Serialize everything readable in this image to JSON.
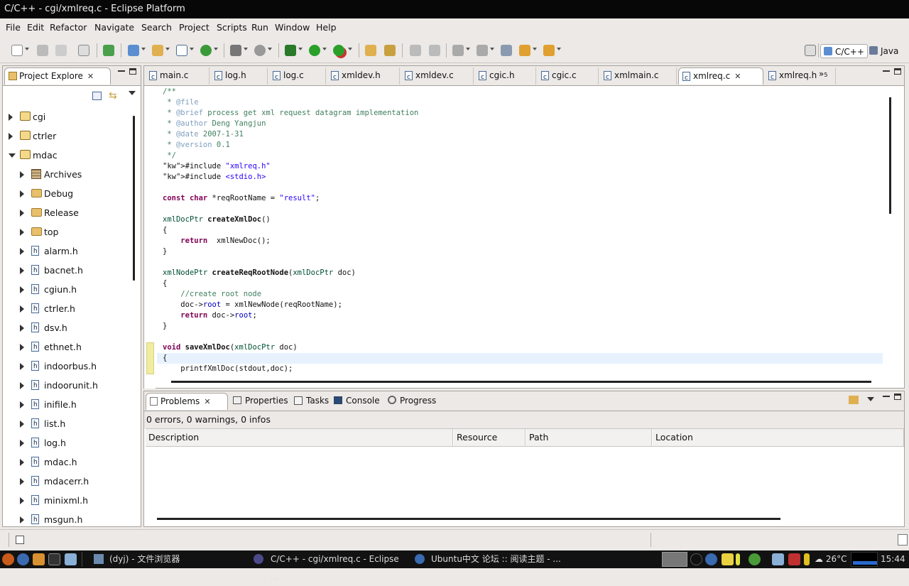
{
  "window": {
    "title": "C/C++ - cgi/xmlreq.c - Eclipse Platform"
  },
  "menu": [
    "File",
    "Edit",
    "Refactor",
    "Navigate",
    "Search",
    "Project",
    "Scripts",
    "Run",
    "Window",
    "Help"
  ],
  "perspectives": {
    "cpp": "C/C++",
    "java": "Java"
  },
  "explorer": {
    "title": "Project Explore",
    "items": [
      {
        "label": "cgi",
        "type": "project",
        "level": 0,
        "expanded": false
      },
      {
        "label": "ctrler",
        "type": "project",
        "level": 0,
        "expanded": false
      },
      {
        "label": "mdac",
        "type": "project",
        "level": 0,
        "expanded": true
      },
      {
        "label": "Archives",
        "type": "archives",
        "level": 1
      },
      {
        "label": "Debug",
        "type": "folder",
        "level": 1
      },
      {
        "label": "Release",
        "type": "folder",
        "level": 1
      },
      {
        "label": "top",
        "type": "folder",
        "level": 1
      },
      {
        "label": "alarm.h",
        "type": "header",
        "level": 1
      },
      {
        "label": "bacnet.h",
        "type": "header",
        "level": 1
      },
      {
        "label": "cgiun.h",
        "type": "header",
        "level": 1
      },
      {
        "label": "ctrler.h",
        "type": "header",
        "level": 1
      },
      {
        "label": "dsv.h",
        "type": "header",
        "level": 1
      },
      {
        "label": "ethnet.h",
        "type": "header",
        "level": 1
      },
      {
        "label": "indoorbus.h",
        "type": "header",
        "level": 1
      },
      {
        "label": "indoorunit.h",
        "type": "header",
        "level": 1
      },
      {
        "label": "inifile.h",
        "type": "header",
        "level": 1
      },
      {
        "label": "list.h",
        "type": "header",
        "level": 1
      },
      {
        "label": "log.h",
        "type": "header",
        "level": 1
      },
      {
        "label": "mdac.h",
        "type": "header",
        "level": 1
      },
      {
        "label": "mdacerr.h",
        "type": "header",
        "level": 1
      },
      {
        "label": "minixml.h",
        "type": "header",
        "level": 1
      },
      {
        "label": "msgun.h",
        "type": "header",
        "level": 1
      }
    ]
  },
  "editor": {
    "tabs": [
      "main.c",
      "log.h",
      "log.c",
      "xmldev.h",
      "xmldev.c",
      "cgic.h",
      "cgic.c",
      "xmlmain.c",
      "xmlreq.c",
      "xmlreq.h"
    ],
    "active_tab": "xmlreq.c",
    "overflow": "»",
    "overflow_count": "5",
    "code": [
      "/**",
      " * @file",
      " * @brief process get xml request datagram implementation",
      " * @author Deng Yangjun",
      " * @date 2007-1-31",
      " * @version 0.1",
      " */",
      "#include \"xmlreq.h\"",
      "#include <stdio.h>",
      "",
      "const char *reqRootName = \"result\";",
      "",
      "xmlDocPtr createXmlDoc()",
      "{",
      "    return  xmlNewDoc();",
      "}",
      "",
      "xmlNodePtr createReqRootNode(xmlDocPtr doc)",
      "{",
      "    //create root node",
      "    doc->root = xmlNewNode(reqRootName);",
      "    return doc->root;",
      "}",
      "",
      "void saveXmlDoc(xmlDocPtr doc)",
      "{",
      "    printfXmlDoc(stdout,doc);"
    ]
  },
  "bottom": {
    "tabs": [
      "Problems",
      "Properties",
      "Tasks",
      "Console",
      "Progress"
    ],
    "summary": "0 errors, 0 warnings, 0 infos",
    "columns": [
      "Description",
      "Resource",
      "Path",
      "Location"
    ]
  },
  "taskbar": {
    "items": [
      "(dyj) - 文件浏览器",
      "C/C++ - cgi/xmlreq.c - Eclipse ...",
      "Ubuntu中文 论坛 :: 阅读主题 - ..."
    ],
    "weather": "26°C",
    "clock": "15:44"
  },
  "colors": {
    "titlebar": "#070707",
    "panel_bg": "#ece9e6",
    "comment": "#3f7f5f",
    "keyword": "#7f0055",
    "string": "#2a00ff",
    "field": "#0000c0"
  }
}
